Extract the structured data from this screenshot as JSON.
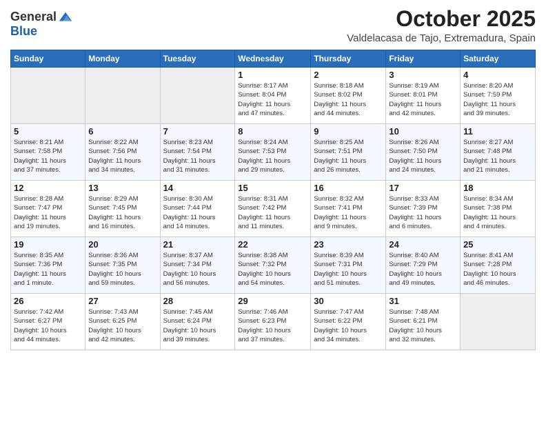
{
  "logo": {
    "general": "General",
    "blue": "Blue"
  },
  "header": {
    "month": "October 2025",
    "location": "Valdelacasa de Tajo, Extremadura, Spain"
  },
  "weekdays": [
    "Sunday",
    "Monday",
    "Tuesday",
    "Wednesday",
    "Thursday",
    "Friday",
    "Saturday"
  ],
  "weeks": [
    [
      {
        "day": "",
        "info": ""
      },
      {
        "day": "",
        "info": ""
      },
      {
        "day": "",
        "info": ""
      },
      {
        "day": "1",
        "info": "Sunrise: 8:17 AM\nSunset: 8:04 PM\nDaylight: 11 hours\nand 47 minutes."
      },
      {
        "day": "2",
        "info": "Sunrise: 8:18 AM\nSunset: 8:02 PM\nDaylight: 11 hours\nand 44 minutes."
      },
      {
        "day": "3",
        "info": "Sunrise: 8:19 AM\nSunset: 8:01 PM\nDaylight: 11 hours\nand 42 minutes."
      },
      {
        "day": "4",
        "info": "Sunrise: 8:20 AM\nSunset: 7:59 PM\nDaylight: 11 hours\nand 39 minutes."
      }
    ],
    [
      {
        "day": "5",
        "info": "Sunrise: 8:21 AM\nSunset: 7:58 PM\nDaylight: 11 hours\nand 37 minutes."
      },
      {
        "day": "6",
        "info": "Sunrise: 8:22 AM\nSunset: 7:56 PM\nDaylight: 11 hours\nand 34 minutes."
      },
      {
        "day": "7",
        "info": "Sunrise: 8:23 AM\nSunset: 7:54 PM\nDaylight: 11 hours\nand 31 minutes."
      },
      {
        "day": "8",
        "info": "Sunrise: 8:24 AM\nSunset: 7:53 PM\nDaylight: 11 hours\nand 29 minutes."
      },
      {
        "day": "9",
        "info": "Sunrise: 8:25 AM\nSunset: 7:51 PM\nDaylight: 11 hours\nand 26 minutes."
      },
      {
        "day": "10",
        "info": "Sunrise: 8:26 AM\nSunset: 7:50 PM\nDaylight: 11 hours\nand 24 minutes."
      },
      {
        "day": "11",
        "info": "Sunrise: 8:27 AM\nSunset: 7:48 PM\nDaylight: 11 hours\nand 21 minutes."
      }
    ],
    [
      {
        "day": "12",
        "info": "Sunrise: 8:28 AM\nSunset: 7:47 PM\nDaylight: 11 hours\nand 19 minutes."
      },
      {
        "day": "13",
        "info": "Sunrise: 8:29 AM\nSunset: 7:45 PM\nDaylight: 11 hours\nand 16 minutes."
      },
      {
        "day": "14",
        "info": "Sunrise: 8:30 AM\nSunset: 7:44 PM\nDaylight: 11 hours\nand 14 minutes."
      },
      {
        "day": "15",
        "info": "Sunrise: 8:31 AM\nSunset: 7:42 PM\nDaylight: 11 hours\nand 11 minutes."
      },
      {
        "day": "16",
        "info": "Sunrise: 8:32 AM\nSunset: 7:41 PM\nDaylight: 11 hours\nand 9 minutes."
      },
      {
        "day": "17",
        "info": "Sunrise: 8:33 AM\nSunset: 7:39 PM\nDaylight: 11 hours\nand 6 minutes."
      },
      {
        "day": "18",
        "info": "Sunrise: 8:34 AM\nSunset: 7:38 PM\nDaylight: 11 hours\nand 4 minutes."
      }
    ],
    [
      {
        "day": "19",
        "info": "Sunrise: 8:35 AM\nSunset: 7:36 PM\nDaylight: 11 hours\nand 1 minute."
      },
      {
        "day": "20",
        "info": "Sunrise: 8:36 AM\nSunset: 7:35 PM\nDaylight: 10 hours\nand 59 minutes."
      },
      {
        "day": "21",
        "info": "Sunrise: 8:37 AM\nSunset: 7:34 PM\nDaylight: 10 hours\nand 56 minutes."
      },
      {
        "day": "22",
        "info": "Sunrise: 8:38 AM\nSunset: 7:32 PM\nDaylight: 10 hours\nand 54 minutes."
      },
      {
        "day": "23",
        "info": "Sunrise: 8:39 AM\nSunset: 7:31 PM\nDaylight: 10 hours\nand 51 minutes."
      },
      {
        "day": "24",
        "info": "Sunrise: 8:40 AM\nSunset: 7:29 PM\nDaylight: 10 hours\nand 49 minutes."
      },
      {
        "day": "25",
        "info": "Sunrise: 8:41 AM\nSunset: 7:28 PM\nDaylight: 10 hours\nand 46 minutes."
      }
    ],
    [
      {
        "day": "26",
        "info": "Sunrise: 7:42 AM\nSunset: 6:27 PM\nDaylight: 10 hours\nand 44 minutes."
      },
      {
        "day": "27",
        "info": "Sunrise: 7:43 AM\nSunset: 6:25 PM\nDaylight: 10 hours\nand 42 minutes."
      },
      {
        "day": "28",
        "info": "Sunrise: 7:45 AM\nSunset: 6:24 PM\nDaylight: 10 hours\nand 39 minutes."
      },
      {
        "day": "29",
        "info": "Sunrise: 7:46 AM\nSunset: 6:23 PM\nDaylight: 10 hours\nand 37 minutes."
      },
      {
        "day": "30",
        "info": "Sunrise: 7:47 AM\nSunset: 6:22 PM\nDaylight: 10 hours\nand 34 minutes."
      },
      {
        "day": "31",
        "info": "Sunrise: 7:48 AM\nSunset: 6:21 PM\nDaylight: 10 hours\nand 32 minutes."
      },
      {
        "day": "",
        "info": ""
      }
    ]
  ]
}
